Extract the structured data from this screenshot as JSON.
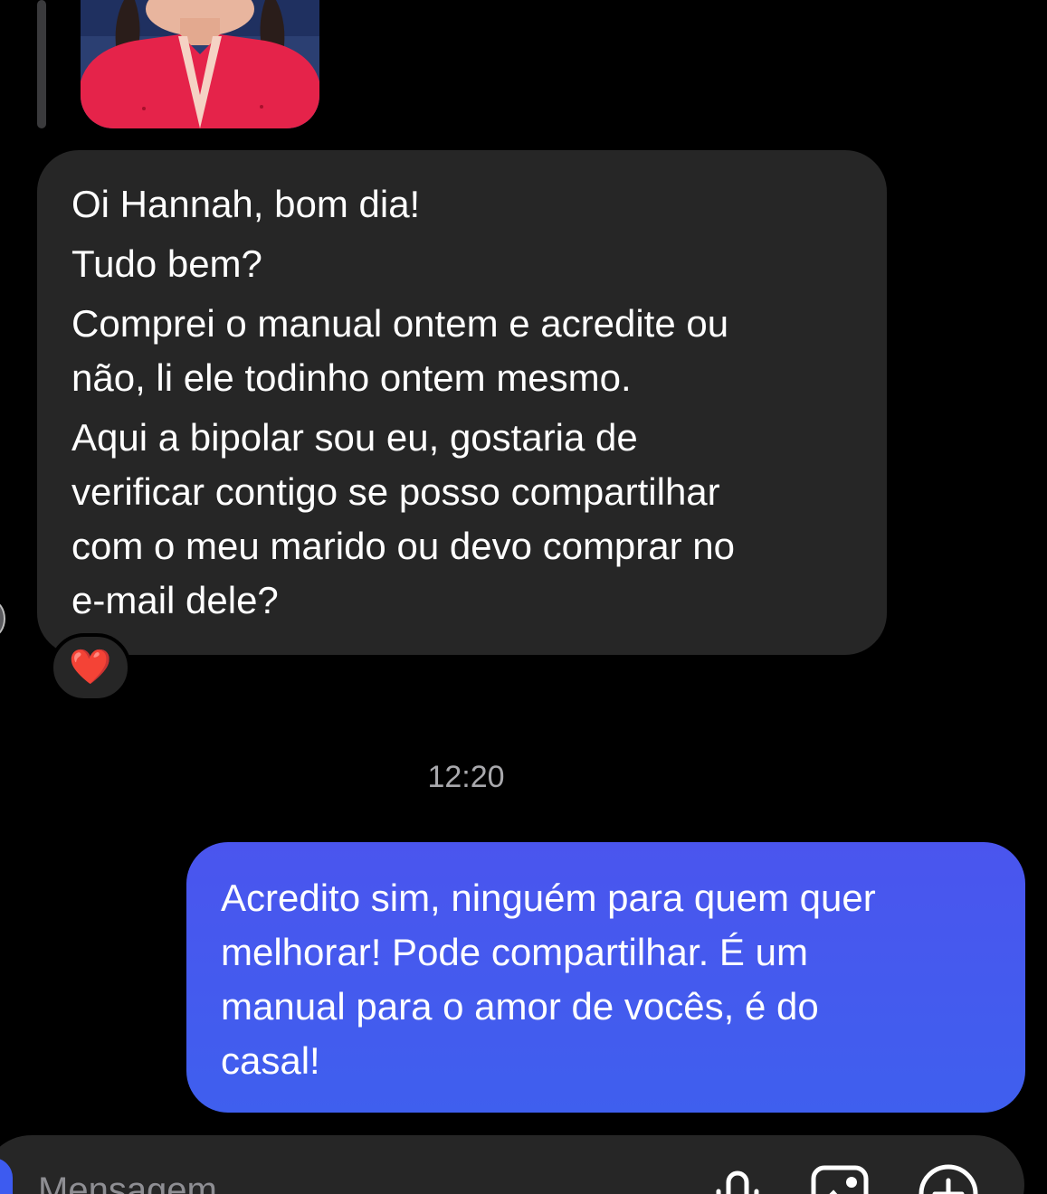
{
  "conversation": {
    "incoming_message": {
      "paragraphs": [
        [
          "Oi Hannah, bom dia!"
        ],
        [
          "Tudo bem?"
        ],
        [
          "Comprei o manual ontem e acredite ou",
          "não, li ele todinho ontem mesmo."
        ],
        [
          "Aqui a bipolar sou eu, gostaria de",
          "verificar contigo se posso compartilhar",
          "com o meu marido ou devo comprar no",
          "e-mail dele?"
        ]
      ],
      "reaction": "❤️"
    },
    "timestamp": "12:20",
    "outgoing_message": {
      "lines": [
        "Acredito sim, ninguém para quem quer",
        "melhorar!  Pode compartilhar. É um",
        "manual para o amor de vocês, é do",
        "casal!"
      ]
    }
  },
  "composer": {
    "placeholder": "Mensagem",
    "icons": [
      "microphone-icon",
      "gallery-icon",
      "add-icon"
    ]
  },
  "colors": {
    "background": "#000000",
    "incoming_bubble": "#262626",
    "outgoing_bubble": "#4a55ee",
    "timestamp": "#a9a9ad",
    "accent": "#3d5bf0"
  }
}
